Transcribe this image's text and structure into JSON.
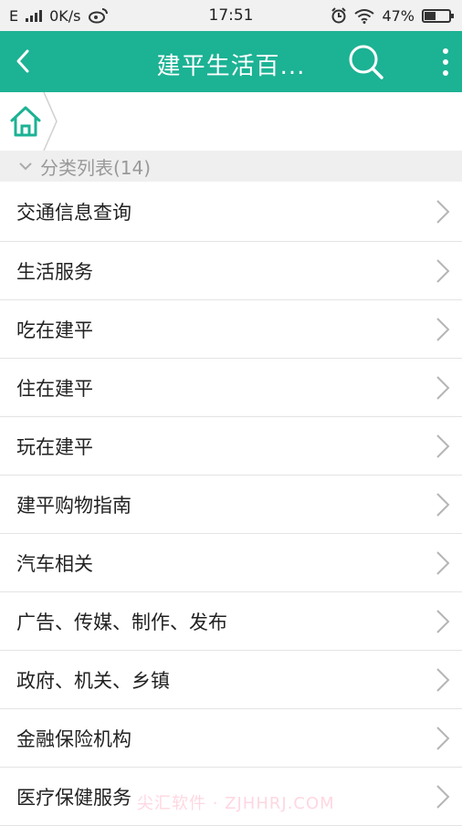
{
  "status_bar": {
    "network": "E",
    "speed": "0K/s",
    "time": "17:51",
    "battery": "47%",
    "battery_level": 0.47
  },
  "header": {
    "title": "建平生活百...",
    "back_icon": "back-arrow-icon",
    "search_icon": "search-icon",
    "more_icon": "more-vertical-icon",
    "color": "#1cb294"
  },
  "breadcrumb": {
    "home_icon": "home-icon"
  },
  "section": {
    "label": "分类列表(14)"
  },
  "list": [
    {
      "label": "交通信息查询"
    },
    {
      "label": "生活服务"
    },
    {
      "label": "吃在建平"
    },
    {
      "label": "住在建平"
    },
    {
      "label": "玩在建平"
    },
    {
      "label": "建平购物指南"
    },
    {
      "label": "汽车相关"
    },
    {
      "label": "广告、传媒、制作、发布"
    },
    {
      "label": "政府、机关、乡镇"
    },
    {
      "label": "金融保险机构"
    },
    {
      "label": "医疗保健服务"
    }
  ],
  "watermark": "尖汇软件 · ZJHHRJ.COM"
}
